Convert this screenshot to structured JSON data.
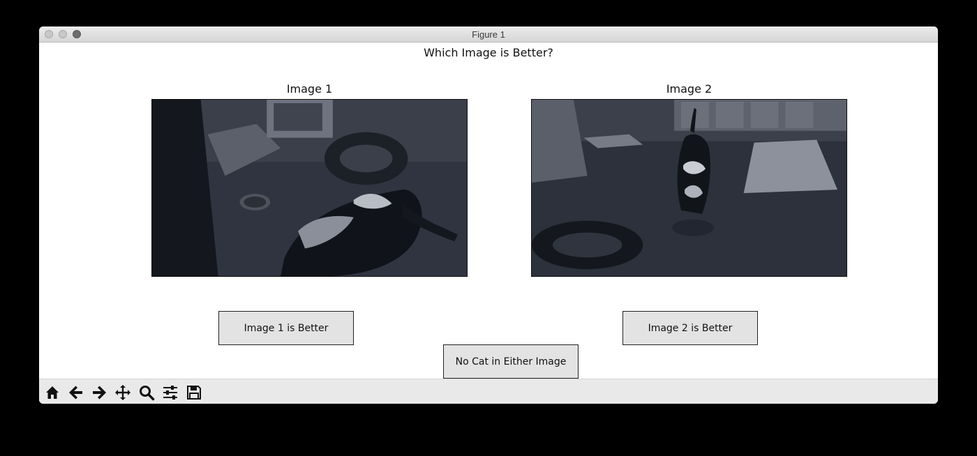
{
  "window": {
    "title": "Figure 1"
  },
  "figure": {
    "suptitle": "Which Image is Better?",
    "panels": [
      {
        "title": "Image 1"
      },
      {
        "title": "Image 2"
      }
    ]
  },
  "buttons": {
    "image1_better": "Image 1 is Better",
    "image2_better": "Image 2 is Better",
    "no_cat": "No Cat in Either Image"
  },
  "toolbar": {
    "tools": [
      "home-icon",
      "back-arrow-icon",
      "forward-arrow-icon",
      "pan-move-icon",
      "zoom-magnifier-icon",
      "configure-subplots-icon",
      "save-floppy-icon"
    ]
  },
  "colors": {
    "image_tint": "#30353f",
    "button_face": "#e3e3e3",
    "toolbar_bg": "#e9e9e9"
  }
}
